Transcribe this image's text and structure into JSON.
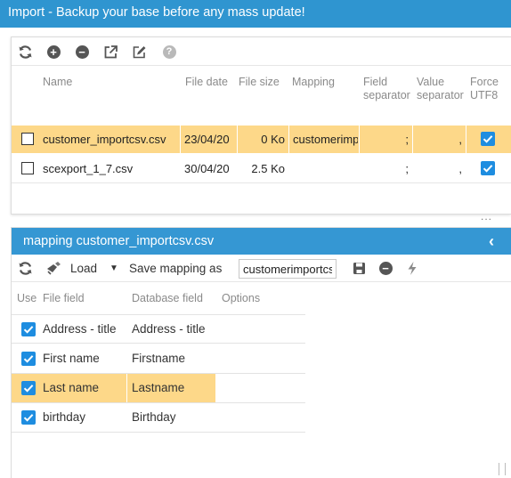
{
  "window": {
    "title": "Import - Backup your base before any mass update!"
  },
  "toolbar": {
    "icons": [
      "refresh-icon",
      "add-icon",
      "remove-icon",
      "export-icon",
      "edit-icon",
      "help-icon"
    ]
  },
  "files": {
    "columns": [
      "Name",
      "File date",
      "File size",
      "Mapping",
      "Field separator",
      "Value separator",
      "Force UTF8"
    ],
    "rows": [
      {
        "name": "customer_importcsv.csv",
        "date": "23/04/20",
        "size": "0 Ko",
        "mapping": "customerimp",
        "field_sep": ";",
        "value_sep": ",",
        "force_utf8": true,
        "selected": true
      },
      {
        "name": "scexport_1_7.csv",
        "date": "30/04/20",
        "size": "2.5 Ko",
        "mapping": "",
        "field_sep": ";",
        "value_sep": ",",
        "force_utf8": true,
        "selected": false
      }
    ]
  },
  "resize_handle": "...",
  "mapping_panel": {
    "title": "mapping customer_importcsv.csv",
    "collapse_glyph": "‹",
    "load_label": "Load",
    "save_mapping_label": "Save mapping as",
    "mapping_name_value": "customerimportcsv",
    "columns": [
      "Use",
      "File field",
      "Database field",
      "Options"
    ],
    "rows": [
      {
        "use": true,
        "file_field": "Address - title",
        "db_field": "Address - title",
        "highlighted": false
      },
      {
        "use": true,
        "file_field": "First name",
        "db_field": "Firstname",
        "highlighted": false
      },
      {
        "use": true,
        "file_field": "Last name",
        "db_field": "Lastname",
        "highlighted": true
      },
      {
        "use": true,
        "file_field": "birthday",
        "db_field": "Birthday",
        "highlighted": false
      }
    ]
  },
  "colors": {
    "title_bar": "#2f95d0",
    "panel_header": "#3597d3",
    "selection": "#fdd889",
    "checkbox": "#1e8de0"
  }
}
